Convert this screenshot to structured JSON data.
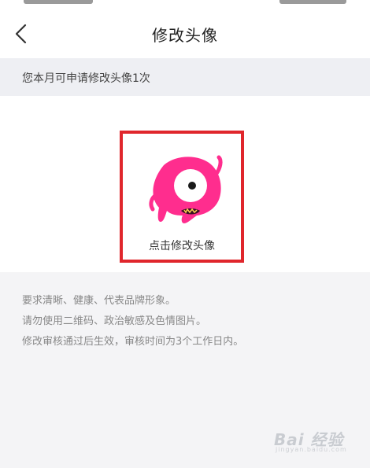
{
  "header": {
    "title": "修改头像",
    "back_icon": "chevron-left-icon"
  },
  "hint": {
    "text": "您本月可申请修改头像1次"
  },
  "avatar": {
    "label": "点击修改头像",
    "highlight_color": "#e0262c",
    "character_color": "#ff2d8e"
  },
  "rules": [
    "要求清晰、健康、代表品牌形象。",
    "请勿使用二维码、政治敏感及色情图片。",
    "修改审核通过后生效，审核时间为3个工作日内。"
  ],
  "watermark": {
    "text": "Bai 经验",
    "sub": "jingyan.baidu.com"
  }
}
